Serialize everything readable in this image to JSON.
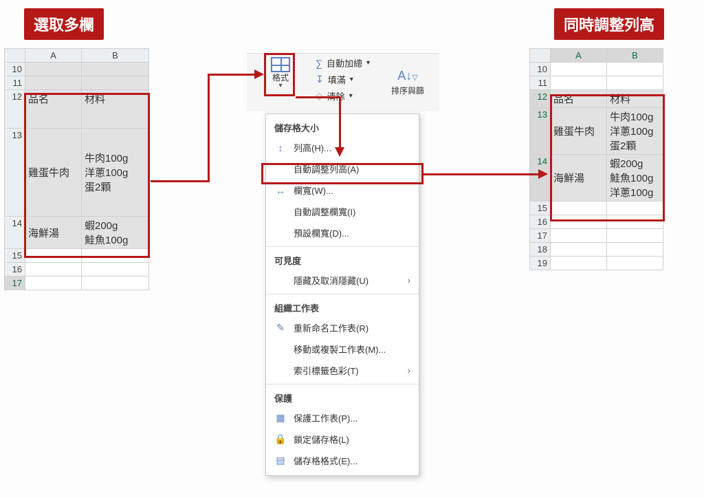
{
  "captions": {
    "left": "選取多欄",
    "right": "同時調整列高"
  },
  "ribbon": {
    "format_label": "格式",
    "autosum": "自動加總",
    "fill": "填滿",
    "clear": "清除",
    "sortfilter": "排序與篩"
  },
  "menu": {
    "section_size": "儲存格大小",
    "row_height": "列高(H)...",
    "auto_row_height": "自動調整列高(A)",
    "col_width": "欄寬(W)...",
    "auto_col_width": "自動調整欄寬(I)",
    "default_width": "預設欄寬(D)...",
    "section_vis": "可見度",
    "hide_unhide": "隱藏及取消隱藏(U)",
    "section_sheet": "組織工作表",
    "rename": "重新命名工作表(R)",
    "move_copy": "移動或複製工作表(M)...",
    "tab_color": "索引標籤色彩(T)",
    "section_protect": "保護",
    "protect_sheet": "保護工作表(P)...",
    "lock_cell": "鎖定儲存格(L)",
    "format_cells": "儲存格格式(E)..."
  },
  "sheet_left": {
    "cols": [
      "A",
      "B"
    ],
    "rows": [
      "10",
      "11",
      "12",
      "13",
      "14",
      "15",
      "16",
      "17"
    ],
    "r12a": "品名",
    "r12b": "材料",
    "r13a": "雞蛋牛肉",
    "r13b": "牛肉100g\n洋蔥100g\n蛋2顆",
    "r14a": "海鮮湯",
    "r14b": "蝦200g\n鮭魚100g"
  },
  "sheet_right": {
    "cols": [
      "A",
      "B"
    ],
    "rows": [
      "10",
      "11",
      "12",
      "13",
      "14",
      "15",
      "16",
      "17",
      "18",
      "19"
    ],
    "r12a": "品名",
    "r12b": "材料",
    "r13a": "雞蛋牛肉",
    "r13b": "牛肉100g\n洋蔥100g\n蛋2顆",
    "r14a": "海鮮湯",
    "r14b": "蝦200g\n鮭魚100g\n洋蔥100g"
  }
}
